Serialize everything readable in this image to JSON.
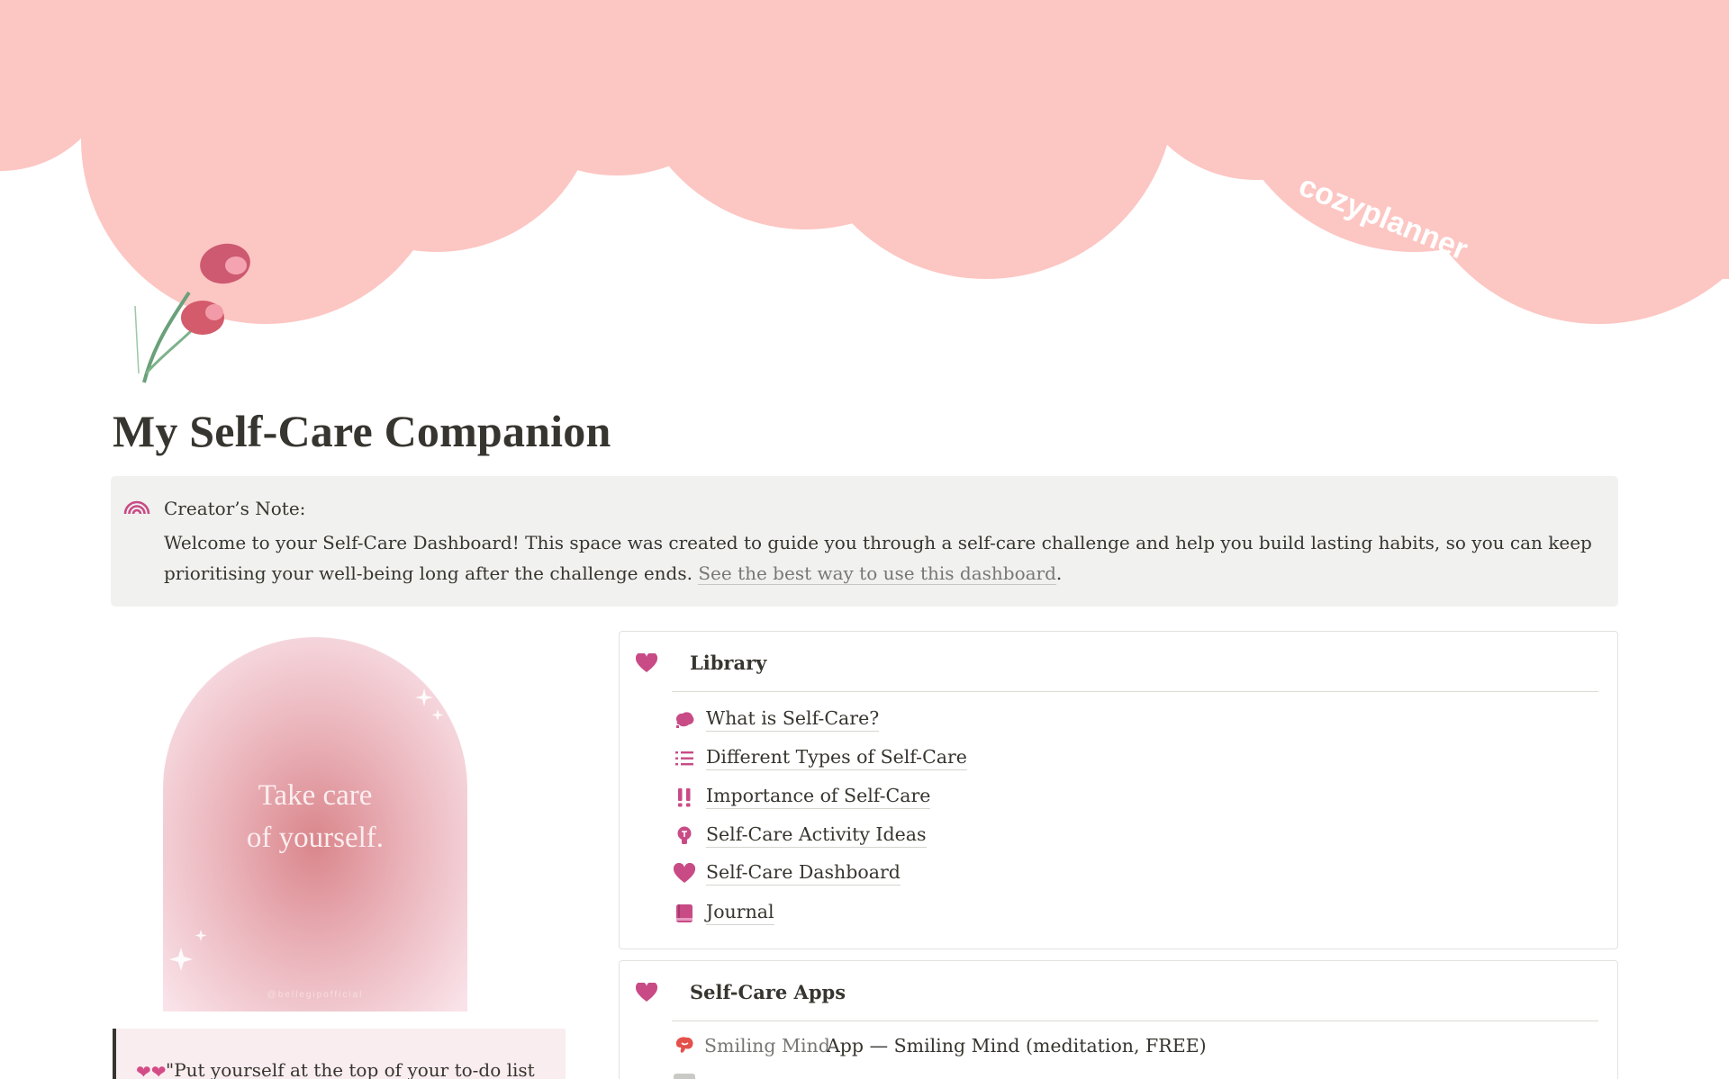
{
  "cover": {
    "brand": "cozyplanner",
    "background_color": "#ffffff",
    "cloud_color": "#fcc6c3"
  },
  "page": {
    "icon": "tulip-icon",
    "title": "My Self-Care Companion"
  },
  "callout": {
    "icon": "rainbow-icon",
    "heading": "Creator’s Note:",
    "body": "Welcome to your Self-Care Dashboard! This space was created to guide you through a self-care challenge and help you build lasting habits, so you can keep prioritising your well-being long after the challenge ends.",
    "link_text": "See the best way to use this dashboard",
    "trailing": "."
  },
  "image_card": {
    "line1": "Take care",
    "line2": "of yourself.",
    "watermark": "@bellegipofficial"
  },
  "quote": {
    "emoji": "two-hearts-icon",
    "text": "\"Put yourself at the top of your to-do list"
  },
  "library": {
    "title": "Library",
    "icon": "heart-icon",
    "items": [
      {
        "label": "What is Self-Care?",
        "icon": "brain-icon"
      },
      {
        "label": "Different Types of Self-Care",
        "icon": "list-icon"
      },
      {
        "label": "Importance of Self-Care",
        "icon": "double-exclamation-icon"
      },
      {
        "label": "Self-Care Activity Ideas",
        "icon": "lightbulb-icon"
      },
      {
        "label": "Self-Care Dashboard",
        "icon": "heart-icon"
      },
      {
        "label": "Journal",
        "icon": "book-icon"
      }
    ]
  },
  "apps": {
    "title": "Self-Care Apps",
    "icon": "heart-icon",
    "items": [
      {
        "link": "Smiling Mind",
        "description": "App — Smiling Mind (meditation, FREE)",
        "icon": "smiling-mind-logo-icon"
      }
    ]
  },
  "colors": {
    "accent_pink": "#c84b86",
    "text": "#37352f",
    "muted": "#787774",
    "callout_bg": "#f1f1ef"
  }
}
